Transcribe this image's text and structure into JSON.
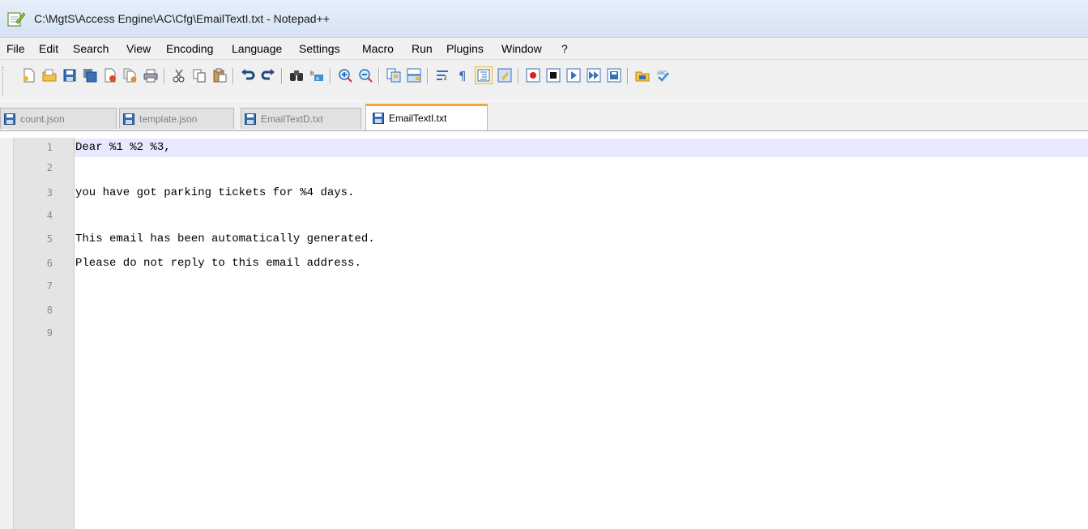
{
  "window": {
    "title": "C:\\MgtS\\Access Engine\\AC\\Cfg\\EmailTextI.txt - Notepad++"
  },
  "menu": [
    {
      "label": "File"
    },
    {
      "label": "Edit"
    },
    {
      "label": "Search"
    },
    {
      "label": "View"
    },
    {
      "label": "Encoding"
    },
    {
      "label": "Language"
    },
    {
      "label": "Settings"
    },
    {
      "label": "Macro"
    },
    {
      "label": "Run"
    },
    {
      "label": "Plugins"
    },
    {
      "label": "Window"
    },
    {
      "label": "?"
    }
  ],
  "toolbar": {
    "buttons": [
      "new-file-icon",
      "open-file-icon",
      "save-icon",
      "save-all-icon",
      "close-icon",
      "close-all-icon",
      "print-icon",
      "cut-icon",
      "copy-icon",
      "paste-icon",
      "undo-icon",
      "redo-icon",
      "find-icon",
      "replace-icon",
      "zoom-in-icon",
      "zoom-out-icon",
      "sync-vertical-icon",
      "sync-horizontal-icon",
      "word-wrap-icon",
      "show-all-characters-icon",
      "indent-guide-icon",
      "user-language-icon",
      "record-macro-icon",
      "stop-recording-icon",
      "playback-macro-icon",
      "run-macro-multiple-icon",
      "save-macro-icon",
      "folder-workspace-icon",
      "spell-check-icon"
    ],
    "active_button": "indent-guide-icon"
  },
  "tabs": [
    {
      "label": "count.json",
      "active": false
    },
    {
      "label": "template.json",
      "active": false
    },
    {
      "label": "EmailTextD.txt",
      "active": false
    },
    {
      "label": "EmailTextI.txt",
      "active": true
    }
  ],
  "editor": {
    "current_line": 1,
    "lines": [
      {
        "number": "1",
        "text": "Dear %1 %2 %3,"
      },
      {
        "number": "2",
        "text": ""
      },
      {
        "number": "3",
        "text": "you have got parking tickets for %4 days."
      },
      {
        "number": "4",
        "text": ""
      },
      {
        "number": "5",
        "text": "This email has been automatically generated."
      },
      {
        "number": "6",
        "text": "Please do not reply to this email address."
      },
      {
        "number": "7",
        "text": ""
      },
      {
        "number": "8",
        "text": ""
      },
      {
        "number": "9",
        "text": ""
      }
    ]
  },
  "colors": {
    "active_tab_accent": "#f7a540",
    "current_line_highlight": "#e8e8ff",
    "gutter": "#e4e4e4"
  }
}
